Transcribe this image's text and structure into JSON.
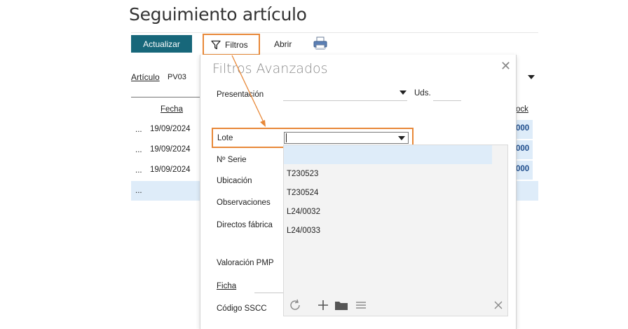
{
  "page": {
    "title": "Seguimiento artículo"
  },
  "toolbar": {
    "actualizar": "Actualizar",
    "filtros": "Filtros",
    "abrir": "Abrir"
  },
  "articulo": {
    "label": "Artículo",
    "value": "PV03"
  },
  "grid": {
    "col_fecha": "Fecha",
    "col_stock": "ock",
    "rows": [
      {
        "dots": "...",
        "fecha": "19/09/2024",
        "stock": "000"
      },
      {
        "dots": "...",
        "fecha": "19/09/2024",
        "stock": "000"
      },
      {
        "dots": "...",
        "fecha": "19/09/2024",
        "stock": "000"
      }
    ],
    "empty_row_dots": "..."
  },
  "filters": {
    "title": "Filtros Avanzados",
    "presentacion": "Presentación",
    "uds": "Uds.",
    "lote": "Lote",
    "lote_value": "",
    "nserie": "Nº Serie",
    "ubicacion": "Ubicación",
    "observaciones": "Observaciones",
    "directos": "Directos fábrica",
    "valoracion": "Valoración PMP",
    "ficha": "Ficha",
    "sscc": "Código SSCC"
  },
  "lote_dropdown": {
    "items": [
      "T230523",
      "T230524",
      "L24/0032",
      "L24/0033"
    ]
  },
  "colors": {
    "accent_teal": "#17677a",
    "highlight_orange": "#e88838",
    "selection_blue": "#deecf9",
    "stock_text": "#1f4d8c"
  }
}
